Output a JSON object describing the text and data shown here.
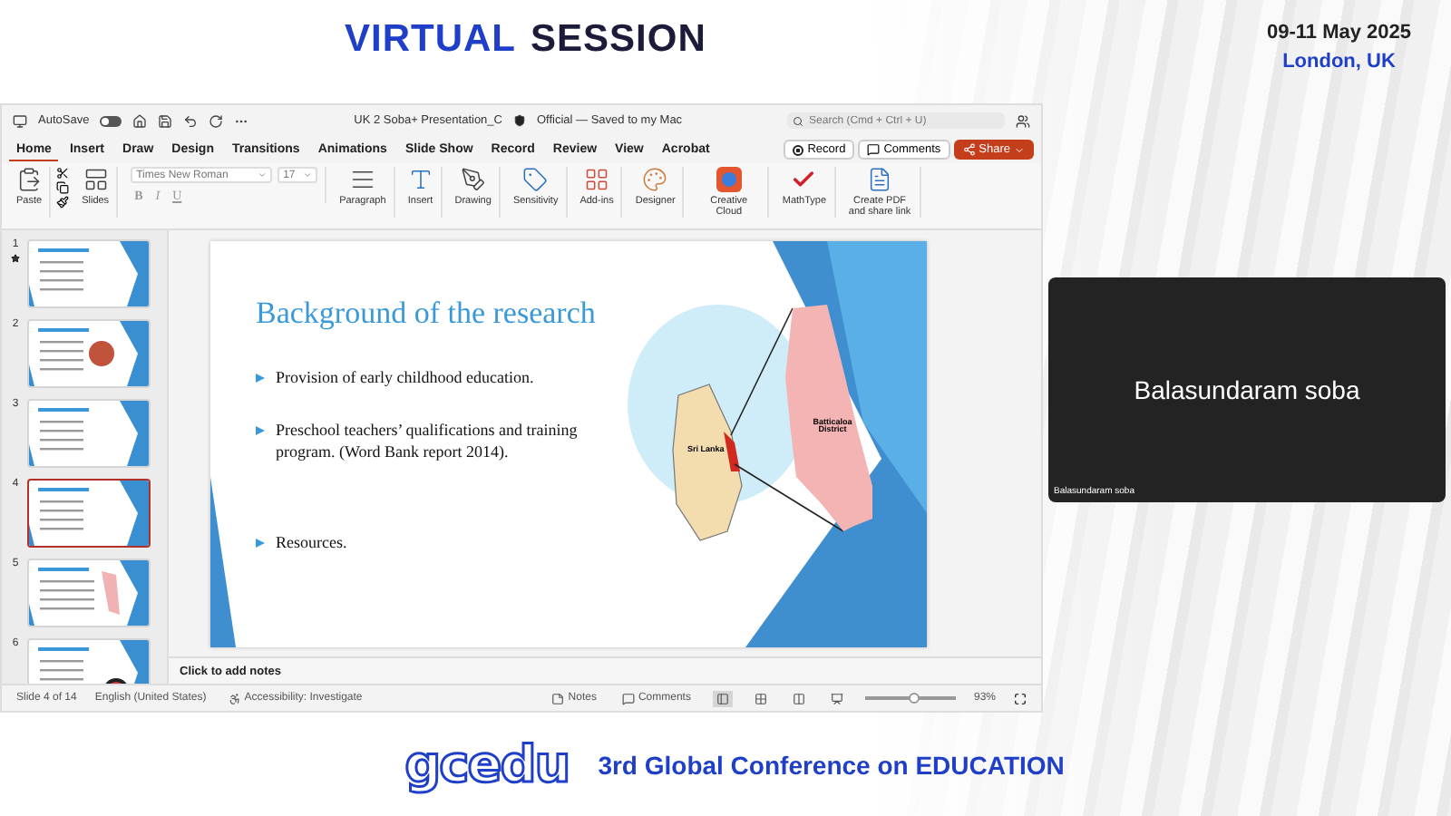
{
  "header": {
    "title_parts": [
      {
        "text": "VIRTUAL",
        "kind": "accent"
      },
      {
        "text": "SESSION",
        "kind": "plain"
      }
    ],
    "date": "09-11 May 2025",
    "location": "London, UK"
  },
  "titlebar": {
    "autosave_label": "AutoSave",
    "autosave_on": false,
    "document": "UK 2 Soba+ Presentation_C",
    "status": "Official — Saved to my Mac",
    "search_placeholder": "Search (Cmd + Ctrl + U)"
  },
  "tabs": [
    {
      "label": "Home",
      "selected": true
    },
    {
      "label": "Insert",
      "selected": false
    },
    {
      "label": "Draw",
      "selected": false
    },
    {
      "label": "Design",
      "selected": false
    },
    {
      "label": "Transitions",
      "selected": false
    },
    {
      "label": "Animations",
      "selected": false
    },
    {
      "label": "Slide Show",
      "selected": false
    },
    {
      "label": "Record",
      "selected": false
    },
    {
      "label": "Review",
      "selected": false
    },
    {
      "label": "View",
      "selected": false
    },
    {
      "label": "Acrobat",
      "selected": false
    }
  ],
  "actions": {
    "record": "Record",
    "comments": "Comments",
    "share": "Share"
  },
  "ribbon": [
    {
      "kind": "paste",
      "label": "Paste"
    },
    {
      "kind": "slides",
      "label": "Slides"
    },
    {
      "kind": "font",
      "font": "Times New Roman",
      "size": "17",
      "format": [
        "B",
        "I",
        "U"
      ]
    },
    {
      "kind": "paragraph",
      "label": "Paragraph"
    },
    {
      "kind": "insert",
      "label": "Insert"
    },
    {
      "kind": "drawing",
      "label": "Drawing"
    },
    {
      "kind": "sensitivity",
      "label": "Sensitivity"
    },
    {
      "kind": "addins",
      "label": "Add-ins"
    },
    {
      "kind": "designer",
      "label": "Designer"
    },
    {
      "kind": "cloud",
      "label": "Creative Cloud"
    },
    {
      "kind": "mathtype",
      "label": "MathType"
    },
    {
      "kind": "pdf",
      "label": "Create PDF and share link"
    }
  ],
  "thumbnails": [
    {
      "number": "1",
      "selected": false,
      "starred": true
    },
    {
      "number": "2",
      "selected": false,
      "starred": false
    },
    {
      "number": "3",
      "selected": false,
      "starred": false
    },
    {
      "number": "4",
      "selected": true,
      "starred": false
    },
    {
      "number": "5",
      "selected": false,
      "starred": false
    },
    {
      "number": "6",
      "selected": false,
      "starred": false
    }
  ],
  "slide": {
    "title": "Background of the research",
    "bullets": [
      "Provision of early childhood education.",
      "Preschool teachers’ qualifications and training program. (Word Bank report 2014).",
      "Resources."
    ],
    "map_labels": [
      "Sri Lanka",
      "Batticaloa District"
    ]
  },
  "notes_placeholder": "Click to add notes",
  "status": {
    "slide": "Slide 4 of 14",
    "language": "English (United States)",
    "accessibility": "Accessibility: Investigate",
    "notes": "Notes",
    "comments": "Comments",
    "level": 0.55,
    "zoom": "93%"
  },
  "participant": {
    "name": "Balasundaram soba",
    "caption": "Balasundaram soba"
  },
  "footer": {
    "logo": "gcedu",
    "conference": "3rd Global Conference on EDUCATION"
  }
}
